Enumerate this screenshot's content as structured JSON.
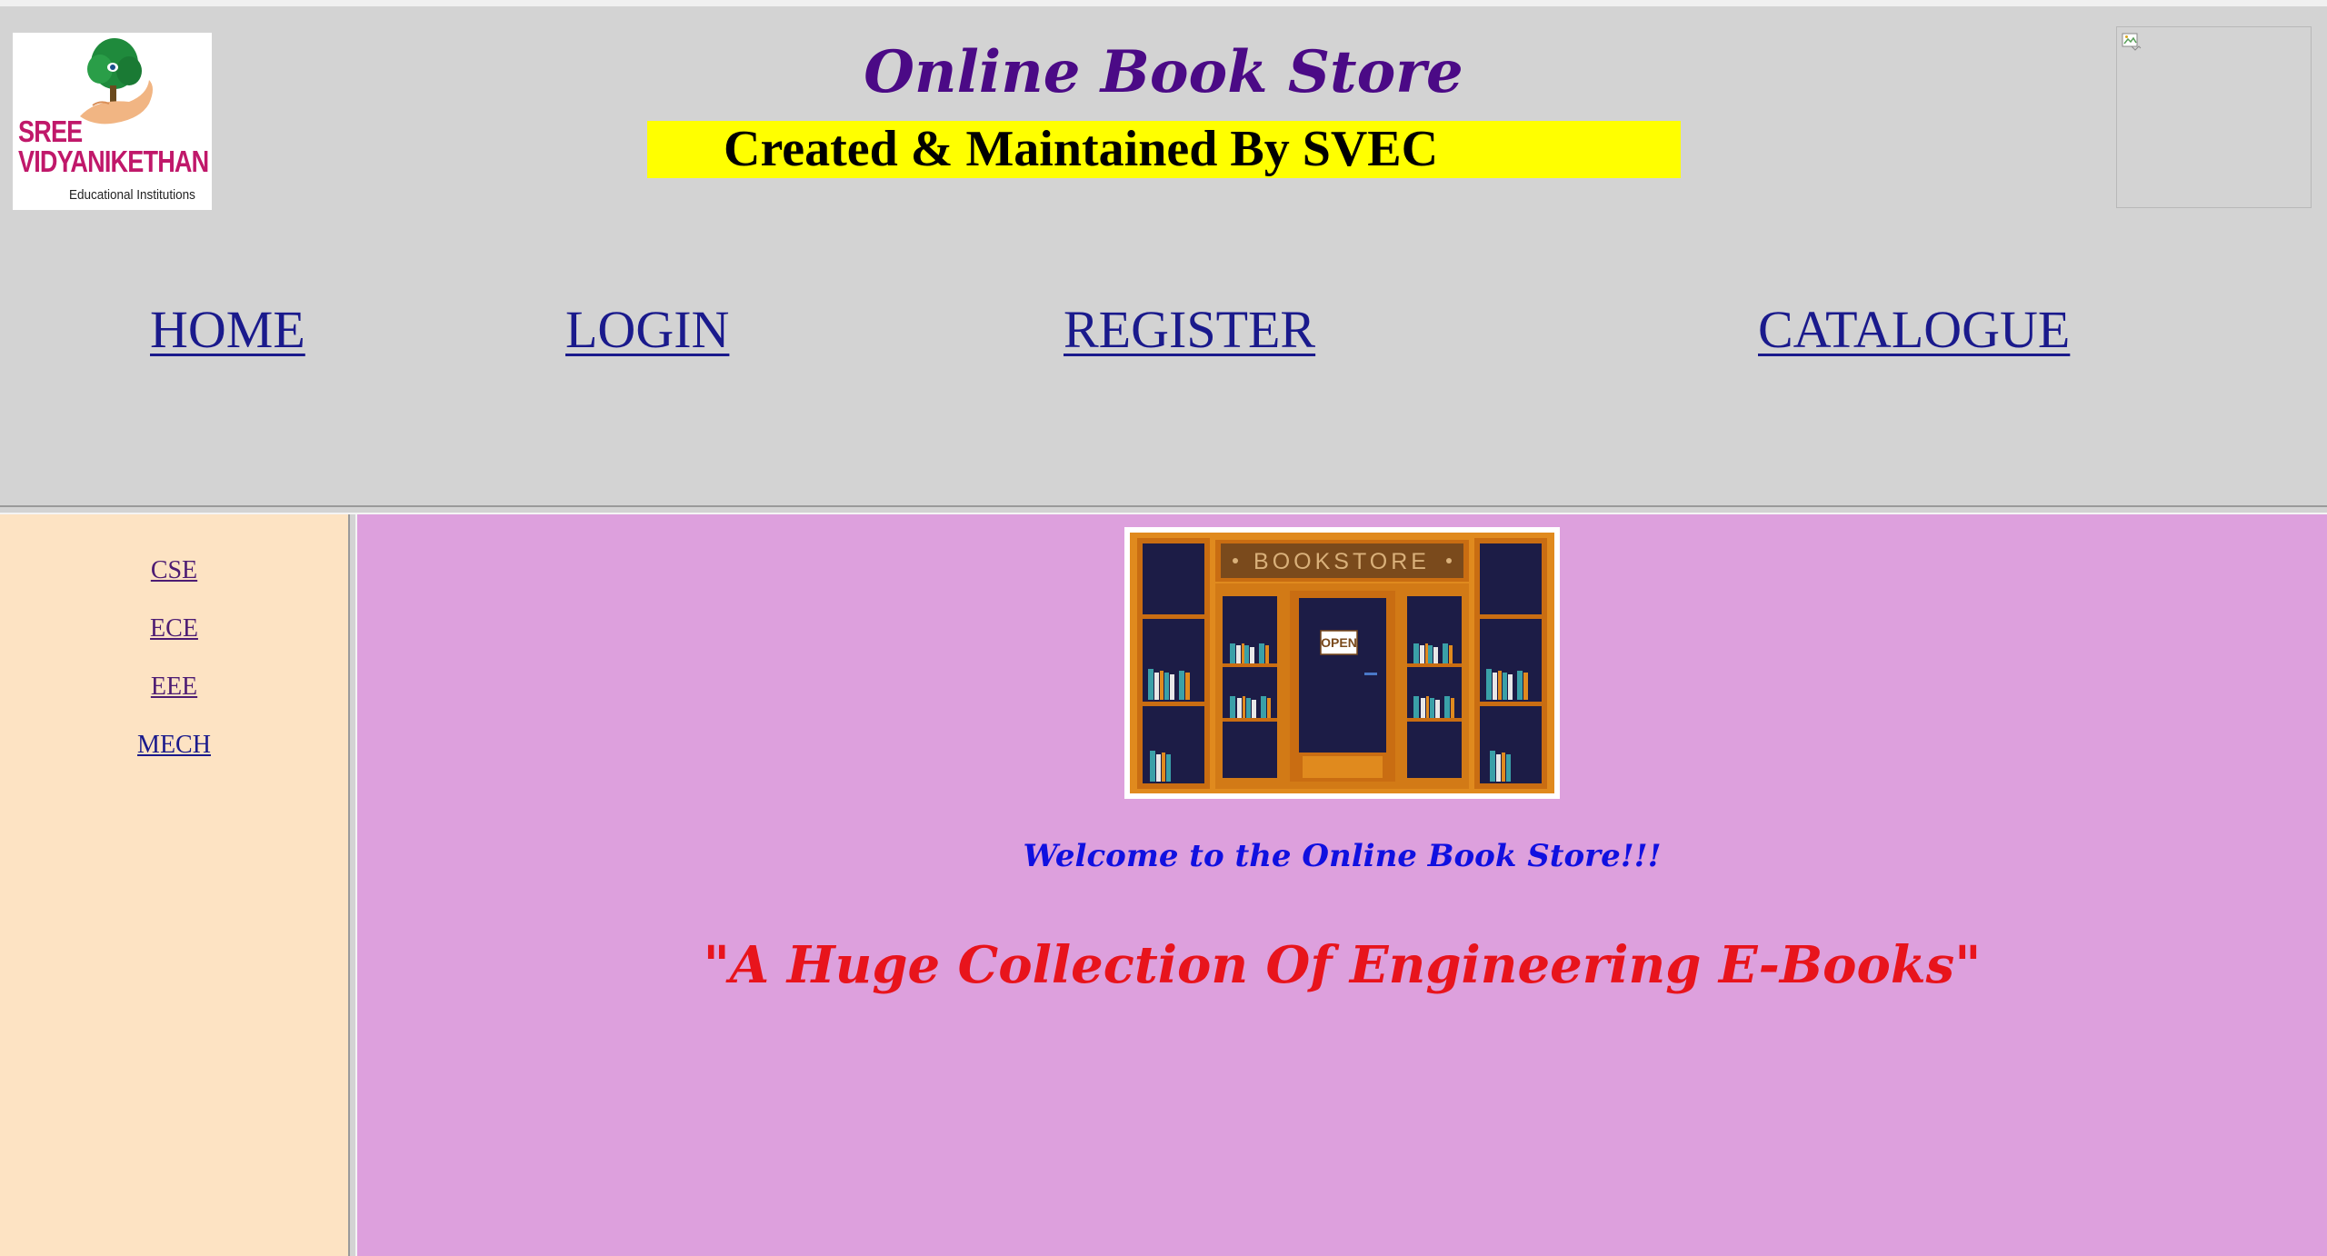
{
  "header": {
    "title": "Online Book Store",
    "banner": "Created & Maintained By SVEC",
    "logo": {
      "line1": "SREE",
      "line2": "VIDYANIKETHAN",
      "subtitle": "Educational Institutions"
    }
  },
  "nav": {
    "items": [
      {
        "label": "HOME"
      },
      {
        "label": "LOGIN"
      },
      {
        "label": "REGISTER"
      },
      {
        "label": "CATALOGUE"
      }
    ]
  },
  "sidebar": {
    "items": [
      {
        "label": "CSE"
      },
      {
        "label": "ECE"
      },
      {
        "label": "EEE"
      },
      {
        "label": "MECH"
      }
    ]
  },
  "main": {
    "image": {
      "sign": "BOOKSTORE",
      "door_sign": "OPEN"
    },
    "welcome": "Welcome to the Online Book Store!!!",
    "tagline": "\"A Huge Collection Of Engineering E-Books\""
  },
  "colors": {
    "header_bg": "#d3d3d3",
    "title": "#4b0a86",
    "banner_bg": "#ffff00",
    "nav_link": "#1a1a8c",
    "sidebar_bg": "#fde3c3",
    "main_bg": "#dda0dd",
    "welcome": "#1010e0",
    "tagline": "#e8141c"
  }
}
